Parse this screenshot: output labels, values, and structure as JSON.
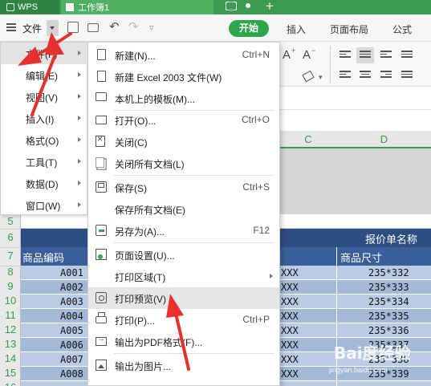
{
  "titlebar": {
    "app_tab": "WPS",
    "doc_tab": "工作簿1"
  },
  "toolbar": {
    "file_label": "文件",
    "start_button": "开始",
    "tabs": [
      "插入",
      "页面布局",
      "公式"
    ]
  },
  "ribbon": {
    "font_larger": "A⁺",
    "font_smaller": "A⁻"
  },
  "columns": {
    "c": "C",
    "d": "D"
  },
  "sheet": {
    "rows": [
      "5",
      "6",
      "7",
      "8",
      "9",
      "10",
      "11",
      "12",
      "13",
      "14",
      "15",
      "16"
    ],
    "title_text": "报价单名称",
    "headers": {
      "code": "商品编码",
      "size": "商品尺寸"
    },
    "data": [
      {
        "code": "A001",
        "name": "XXX",
        "size": "235*332"
      },
      {
        "code": "A002",
        "name": "XXX",
        "size": "235*333"
      },
      {
        "code": "A003",
        "name": "XXX",
        "size": "235*334"
      },
      {
        "code": "A004",
        "name": "XXX",
        "size": "235*335"
      },
      {
        "code": "A005",
        "name": "XXX",
        "size": "235*336"
      },
      {
        "code": "A006",
        "name": "XXX",
        "size": "235*337"
      },
      {
        "code": "A007",
        "name": "XXX",
        "size": "235*338"
      },
      {
        "code": "A008",
        "name": "XXX",
        "size": "235*339"
      }
    ]
  },
  "left_menu": {
    "items": [
      {
        "label": "文件(F)"
      },
      {
        "label": "编辑(E)"
      },
      {
        "label": "视图(V)"
      },
      {
        "label": "插入(I)"
      },
      {
        "label": "格式(O)"
      },
      {
        "label": "工具(T)"
      },
      {
        "label": "数据(D)"
      },
      {
        "label": "窗口(W)"
      }
    ]
  },
  "file_menu": {
    "items": [
      {
        "label": "新建(N)...",
        "shortcut": "Ctrl+N",
        "icon": "new-doc-icon"
      },
      {
        "label": "新建 Excel 2003 文件(W)",
        "shortcut": "",
        "icon": "new-excel-icon"
      },
      {
        "label": "本机上的模板(M)...",
        "shortcut": "",
        "icon": "template-icon"
      },
      {
        "label": "打开(O)...",
        "shortcut": "Ctrl+O",
        "icon": "folder-open-icon"
      },
      {
        "label": "关闭(C)",
        "shortcut": "",
        "icon": "close-doc-icon"
      },
      {
        "label": "关闭所有文档(L)",
        "shortcut": "",
        "icon": "close-all-icon"
      },
      {
        "label": "保存(S)",
        "shortcut": "Ctrl+S",
        "icon": "save-icon"
      },
      {
        "label": "保存所有文档(E)",
        "shortcut": "",
        "icon": ""
      },
      {
        "label": "另存为(A)...",
        "shortcut": "F12",
        "icon": "save-as-icon"
      },
      {
        "label": "页面设置(U)...",
        "shortcut": "",
        "icon": "page-setup-icon"
      },
      {
        "label": "打印区域(T)",
        "shortcut": "",
        "icon": ""
      },
      {
        "label": "打印预览(V)",
        "shortcut": "",
        "icon": "print-preview-icon"
      },
      {
        "label": "打印(P)...",
        "shortcut": "Ctrl+P",
        "icon": "printer-icon"
      },
      {
        "label": "输出为PDF格式(F)...",
        "shortcut": "",
        "icon": "export-pdf-icon"
      },
      {
        "label": "输出为图片...",
        "shortcut": "",
        "icon": "export-image-icon"
      }
    ]
  },
  "watermark": {
    "main": "Bai度经验",
    "sub": "jingyan.baidu.com"
  },
  "colors": {
    "accent_green": "#2ea74a",
    "title_row": "#2e4d80",
    "header_row": "#3a5e99",
    "row_light": "#b9cce4",
    "row_dark": "#a3b9d8",
    "arrow_red": "#e8312f"
  }
}
